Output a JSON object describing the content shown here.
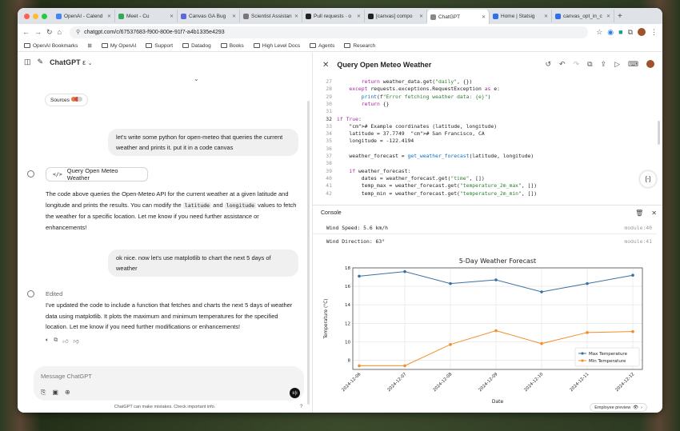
{
  "browser": {
    "tabs": [
      {
        "label": "OpenAI - Calend",
        "color": "#4285f4"
      },
      {
        "label": "Meet - Cu",
        "color": "#34a853"
      },
      {
        "label": "Canvas GA Bug",
        "color": "#5b6bd6"
      },
      {
        "label": "Scientist Assistan",
        "color": "#777777"
      },
      {
        "label": "Pull requests · o",
        "color": "#222222"
      },
      {
        "label": "[canvas] compo",
        "color": "#222222"
      },
      {
        "label": "ChatGPT",
        "color": "#888888",
        "active": true
      },
      {
        "label": "Home | Statsig",
        "color": "#2f6feb"
      },
      {
        "label": "canvas_opt_in_c",
        "color": "#2f6feb"
      }
    ],
    "url": "chatgpt.com/c/67537683-f900-800e-91f7-a4b1335e4293",
    "bookmarks": [
      "OpenAI Bookmarks",
      "My OpenAI",
      "Support",
      "Datadog",
      "Books",
      "High Level Docs",
      "Agents",
      "Research"
    ]
  },
  "chat": {
    "model": "ChatGPT",
    "model_suffix": "ε",
    "sources_label": "Sources",
    "user_msg_1": "let's write some python for open-meteo that queries the current weather and prints it. put it in a code canvas",
    "canvas_chip": "Query Open Meteo Weather",
    "assistant_1": {
      "part1": "The code above queries the Open-Meteo API for the current weather at a given latitude and longitude and prints the results. You can modify the ",
      "code1": "latitude",
      "and": " and ",
      "code2": "longitude",
      "part2": " values to fetch the weather for a specific location. Let me know if you need further assistance or enhancements!"
    },
    "user_msg_2": "ok nice. now let's use matplotlib to chart the next 5 days of weather",
    "edited_label": "Edited",
    "assistant_2": "I've updated the code to include a function that fetches and charts the next 5 days of weather data using matplotlib. It plots the maximum and minimum temperatures for the specified location. Let me know if you need further modifications or enhancements!",
    "input_placeholder": "Message ChatGPT",
    "disclaimer": "ChatGPT can make mistakes. Check important info."
  },
  "canvas": {
    "title": "Query Open Meteo Weather",
    "code_lines": [
      {
        "n": "27",
        "t": "        return weather_data.get(\"daily\", {})"
      },
      {
        "n": "28",
        "t": "    except requests.exceptions.RequestException as e:"
      },
      {
        "n": "29",
        "t": "        print(f\"Error fetching weather data: {e}\")"
      },
      {
        "n": "30",
        "t": "        return {}"
      },
      {
        "n": "31",
        "t": ""
      },
      {
        "n": "32",
        "t": "if True:"
      },
      {
        "n": "33",
        "t": "    # Example coordinates (latitude, longitude)"
      },
      {
        "n": "34",
        "t": "    latitude = 37.7749  # San Francisco, CA"
      },
      {
        "n": "35",
        "t": "    longitude = -122.4194"
      },
      {
        "n": "36",
        "t": ""
      },
      {
        "n": "37",
        "t": "    weather_forecast = get_weather_forecast(latitude, longitude)"
      },
      {
        "n": "38",
        "t": ""
      },
      {
        "n": "39",
        "t": "    if weather_forecast:"
      },
      {
        "n": "40",
        "t": "        dates = weather_forecast.get(\"time\", [])"
      },
      {
        "n": "41",
        "t": "        temp_max = weather_forecast.get(\"temperature_2m_max\", [])"
      },
      {
        "n": "42",
        "t": "        temp_min = weather_forecast.get(\"temperature_2m_min\", [])"
      }
    ],
    "console": {
      "label": "Console",
      "rows": [
        {
          "text": "Wind Speed: 5.6 km/h",
          "module": "module:40"
        },
        {
          "text": "Wind Direction: 63°",
          "module": "module:41"
        }
      ]
    },
    "employee_preview": "Employee preview"
  },
  "chart_data": {
    "type": "line",
    "title": "5-Day Weather Forecast",
    "xlabel": "Date",
    "ylabel": "Temperature (°C)",
    "categories": [
      "2024-12-06",
      "2024-12-07",
      "2024-12-08",
      "2024-12-09",
      "2024-12-10",
      "2024-12-11",
      "2024-12-12"
    ],
    "series": [
      {
        "name": "Max Temperature",
        "color": "#3b6fa0",
        "values": [
          17.1,
          17.6,
          16.3,
          16.7,
          15.4,
          16.3,
          17.2
        ]
      },
      {
        "name": "Min Temperature",
        "color": "#f28e2b",
        "values": [
          7.4,
          7.4,
          9.7,
          11.2,
          9.8,
          11.0,
          11.1
        ]
      }
    ],
    "ylim": [
      7,
      18
    ],
    "yticks": [
      8,
      10,
      12,
      14,
      16,
      18
    ],
    "grid": true,
    "legend": "lower-right"
  }
}
